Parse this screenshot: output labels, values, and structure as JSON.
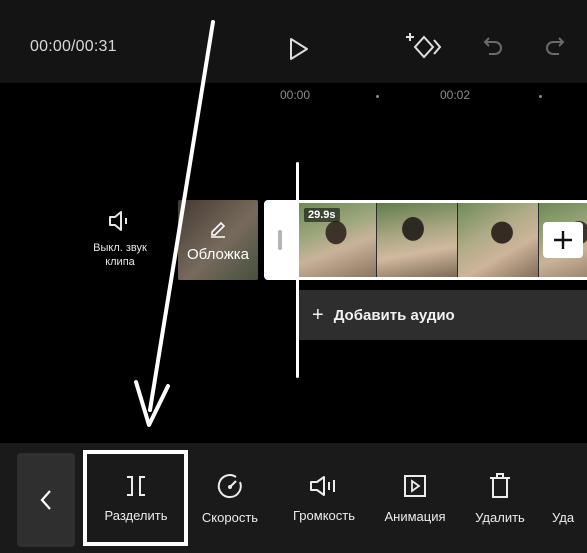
{
  "player": {
    "time": "00:00/00:31"
  },
  "ruler": {
    "marks": [
      "00:00",
      "00:02"
    ]
  },
  "track": {
    "mute_label": "Выкл. звук\nклипа",
    "cover_label": "Обложка",
    "clip_duration": "29.9s",
    "add_audio_label": "Добавить аудио"
  },
  "toolbar": {
    "items": [
      {
        "label": "Разделить",
        "icon": "split-icon"
      },
      {
        "label": "Скорость",
        "icon": "speed-icon"
      },
      {
        "label": "Громкость",
        "icon": "volume-icon"
      },
      {
        "label": "Анимация",
        "icon": "animation-icon"
      },
      {
        "label": "Удалить",
        "icon": "delete-icon"
      },
      {
        "label": "Уда",
        "icon": "partial-icon"
      }
    ]
  },
  "colors": {
    "topbar": "#141414",
    "timeline": "#000000",
    "toolbar": "#1a1a1a",
    "annotation": "#ffffff"
  }
}
